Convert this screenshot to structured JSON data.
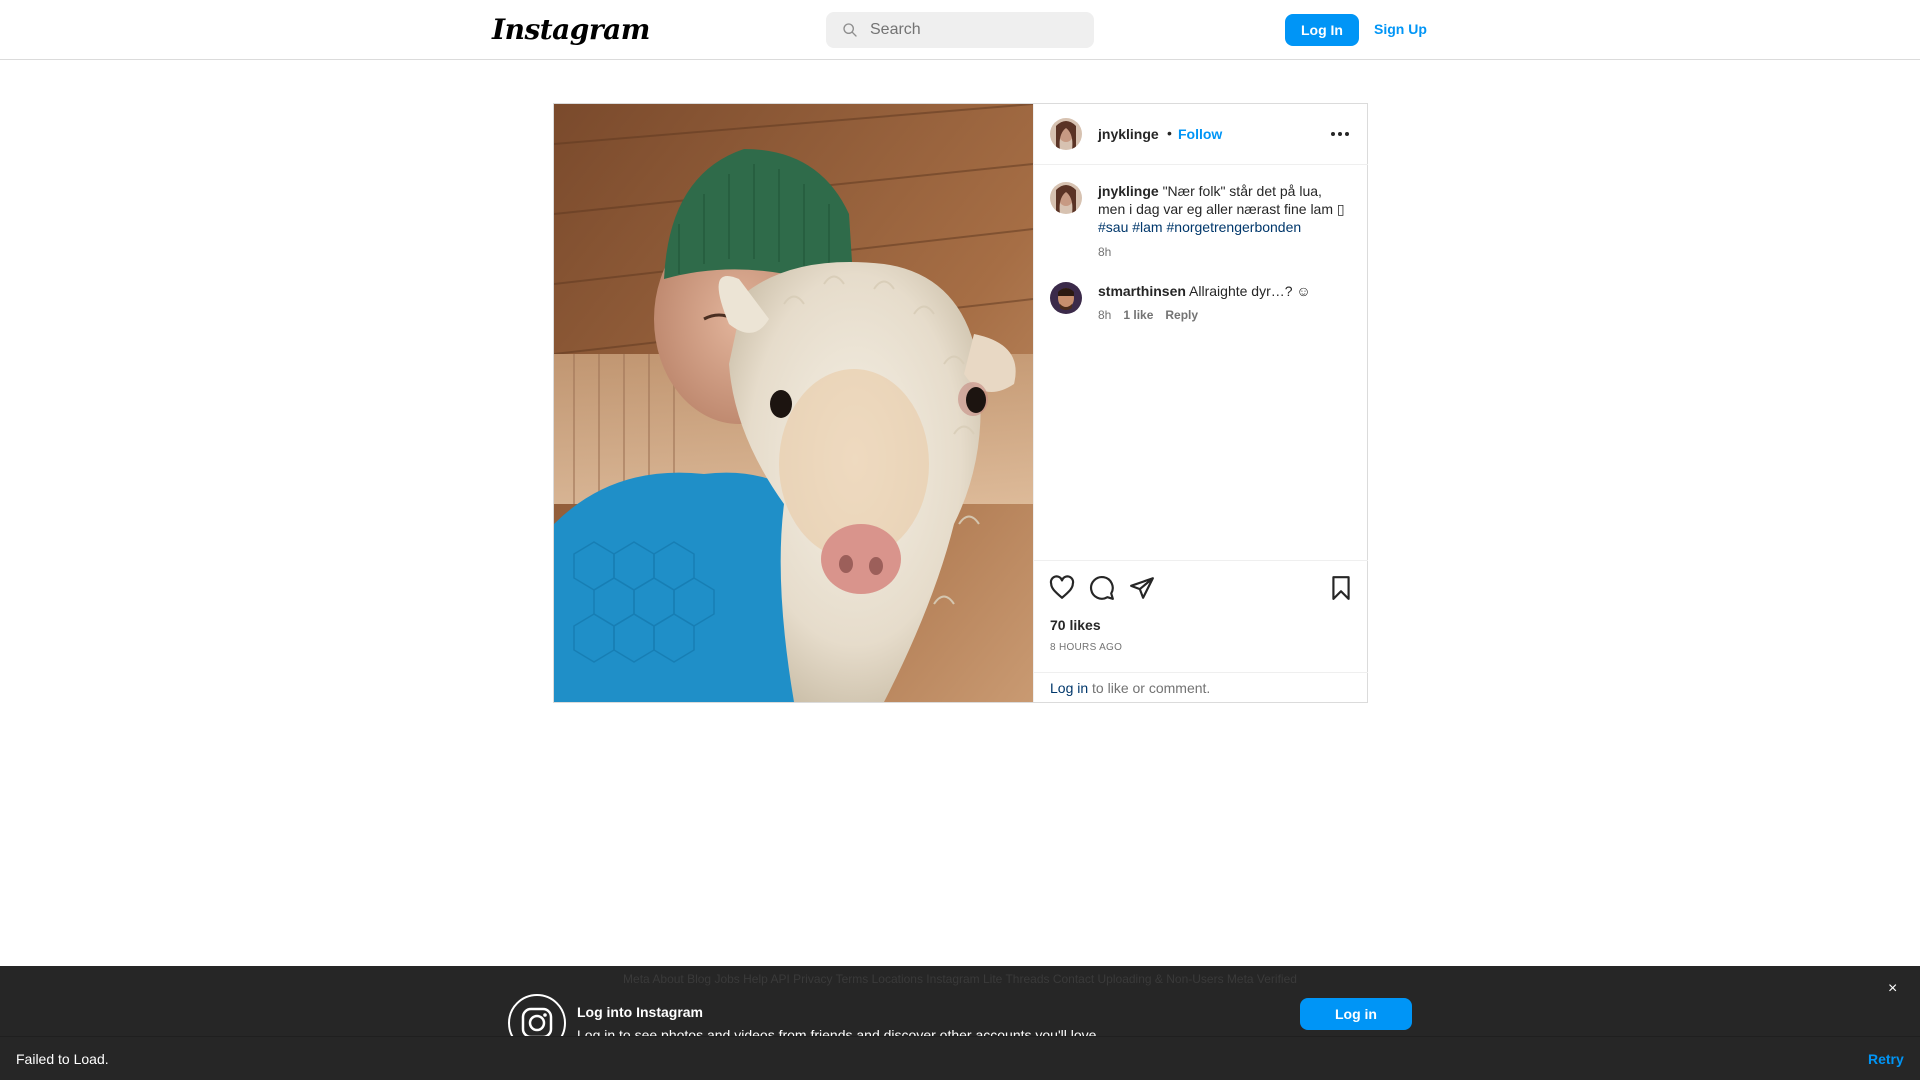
{
  "header": {
    "logo_text": "Instagram",
    "search_placeholder": "Search",
    "login_label": "Log In",
    "signup_label": "Sign Up"
  },
  "post": {
    "author": "jnyklinge",
    "separator": "•",
    "follow_label": "Follow",
    "caption": {
      "username": "jnyklinge",
      "text": "\"Nær folk\" står det på lua, men i dag var eg aller nærast fine lam",
      "glyph": "▯",
      "hashtags": [
        "#sau",
        "#lam",
        "#norgetrengerbonden"
      ],
      "age": "8h"
    },
    "comments": [
      {
        "username": "stmarthinsen",
        "text": "Allraighte dyr…? ☺",
        "age": "8h",
        "likes": "1 like",
        "reply_label": "Reply"
      }
    ],
    "likes_text": "70 likes",
    "posted_ago": "8 HOURS AGO",
    "login_link": "Log in",
    "login_suffix": " to like or comment.",
    "icons": [
      "heart-icon",
      "comment-icon",
      "share-icon",
      "bookmark-icon",
      "more-options-icon"
    ]
  },
  "banner": {
    "ghost_text": "Meta   About   Blog   Jobs   Help   API   Privacy   Terms   Locations   Instagram Lite   Threads   Contact Uploading & Non-Users   Meta Verified",
    "title": "Log into Instagram",
    "subtitle": "Log in to see photos and videos from friends and discover other accounts you'll love.",
    "login_label": "Log in",
    "close_symbol": "×"
  },
  "toast": {
    "message": "Failed to Load.",
    "retry_label": "Retry"
  },
  "colors": {
    "accent": "#0095f6",
    "link_dark": "#00376b",
    "banner_bg": "#262626",
    "border": "#dbdbdb"
  }
}
